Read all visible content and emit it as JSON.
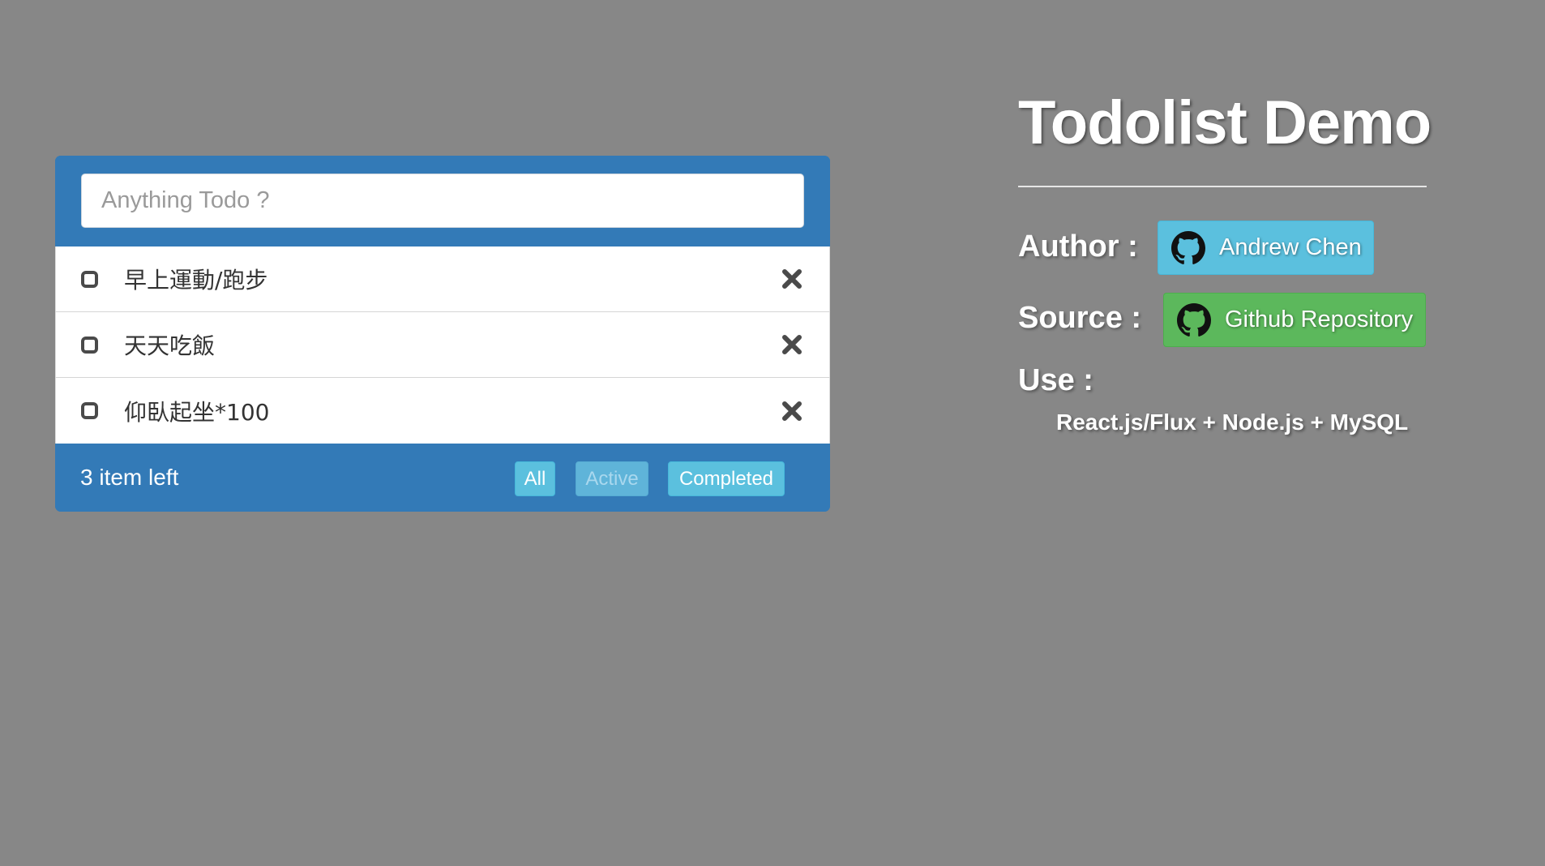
{
  "todo": {
    "input_placeholder": "Anything Todo ?",
    "items": [
      {
        "text": "早上運動/跑步",
        "completed": false
      },
      {
        "text": "天天吃飯",
        "completed": false
      },
      {
        "text": "仰臥起坐*100",
        "completed": false
      }
    ],
    "footer": {
      "items_left": "3 item left",
      "filters": {
        "all": "All",
        "active": "Active",
        "completed": "Completed"
      }
    }
  },
  "info": {
    "title": "Todolist Demo",
    "author_label": "Author :",
    "author_button": "Andrew Chen",
    "source_label": "Source :",
    "source_button": "Github Repository",
    "use_label": "Use :",
    "use_text": "React.js/Flux + Node.js + MySQL"
  },
  "colors": {
    "background": "#878787",
    "primary": "#337ab7",
    "info_button": "#5bc0de",
    "success_button": "#5cb85c"
  },
  "icons": {
    "checkbox": "checkbox-unchecked-icon",
    "delete": "close-x-icon",
    "github": "github-octocat-icon"
  }
}
